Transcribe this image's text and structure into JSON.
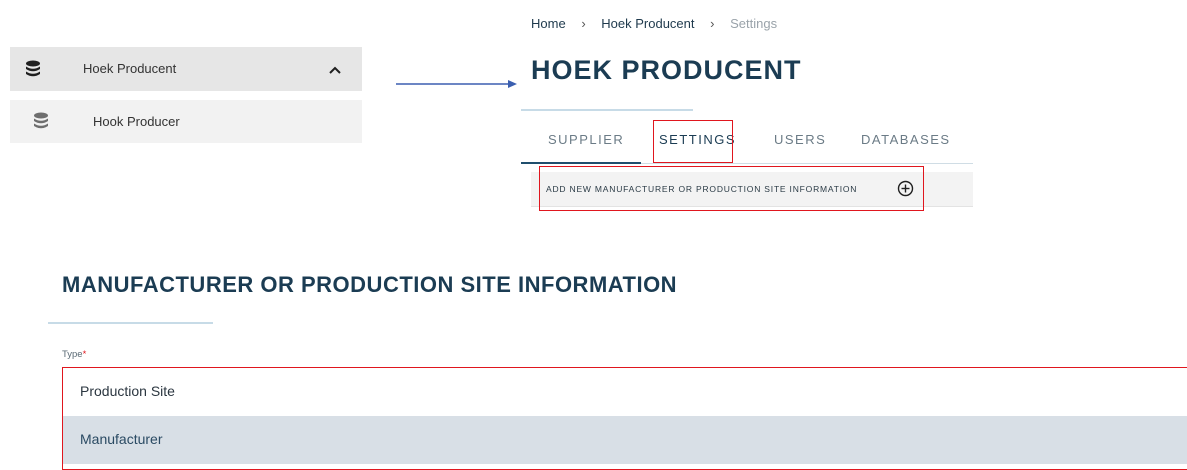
{
  "sidebar": {
    "parent_label": "Hoek Producent",
    "child_label": "Hook Producer"
  },
  "breadcrumb": [
    "Home",
    "Hoek Producent",
    "Settings"
  ],
  "page": {
    "title": "HOEK PRODUCENT"
  },
  "tabs": [
    {
      "label": "SUPPLIER"
    },
    {
      "label": "SETTINGS"
    },
    {
      "label": "USERS"
    },
    {
      "label": "DATABASES"
    }
  ],
  "add_bar": {
    "label": "ADD NEW MANUFACTURER OR PRODUCTION SITE INFORMATION"
  },
  "section": {
    "title": "MANUFACTURER OR PRODUCTION SITE INFORMATION",
    "type_label": "Type",
    "required_mark": "*",
    "options": [
      "Production Site",
      "Manufacturer"
    ]
  },
  "colors": {
    "accent": "#1b3c53",
    "highlight_box": "#e0161e",
    "selected_option_bg": "#d8dfe6",
    "arrow": "#3b5fb0"
  },
  "icons": {
    "database": "database-icon",
    "chevron": "chevron-up-icon",
    "plus": "plus-circle-icon",
    "arrow": "arrow-right-icon"
  }
}
